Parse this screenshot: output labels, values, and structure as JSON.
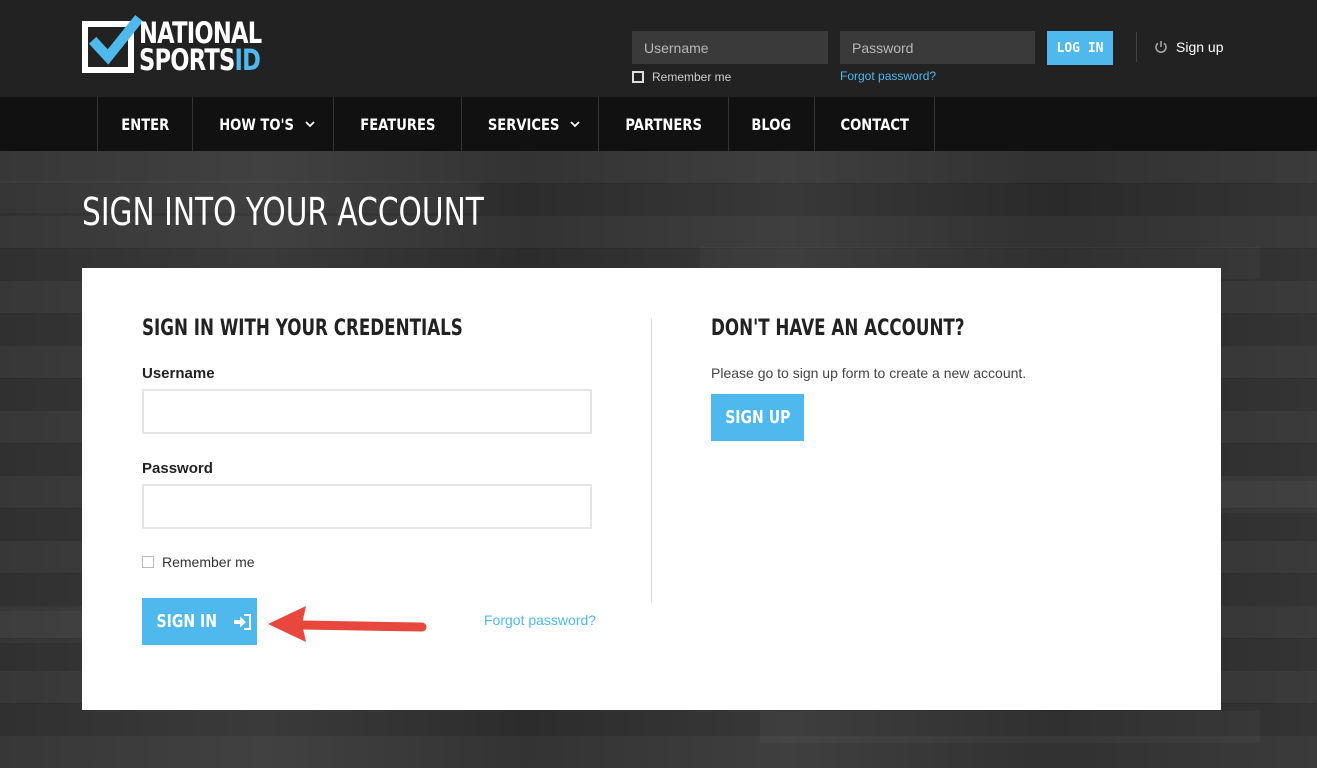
{
  "brand": {
    "line1": "NATIONAL",
    "line2_main": "SPORTS",
    "line2_accent": "ID",
    "accent_color": "#4fb8ec"
  },
  "header": {
    "username_placeholder": "Username",
    "password_placeholder": "Password",
    "remember_label": "Remember me",
    "forgot_label": "Forgot password?",
    "login_label": "LOG IN",
    "signup_label": "Sign up",
    "signup_icon": "power-icon"
  },
  "nav": {
    "items": [
      {
        "label": "ENTER"
      },
      {
        "label": "HOW TO'S",
        "dropdown": true
      },
      {
        "label": "FEATURES"
      },
      {
        "label": "SERVICES",
        "dropdown": true
      },
      {
        "label": "PARTNERS"
      },
      {
        "label": "BLOG"
      },
      {
        "label": "CONTACT"
      }
    ]
  },
  "page": {
    "title": "SIGN INTO YOUR ACCOUNT"
  },
  "signin": {
    "heading": "SIGN IN WITH YOUR CREDENTIALS",
    "username_label": "Username",
    "username_value": "",
    "password_label": "Password",
    "password_value": "",
    "remember_label": "Remember me",
    "button_label": "SIGN IN",
    "button_icon": "sign-in-icon",
    "forgot_label": "Forgot password?"
  },
  "signup": {
    "heading": "DON'T HAVE AN ACCOUNT?",
    "description": "Please go to sign up form to create a new account.",
    "button_label": "SIGN UP"
  },
  "annotation": {
    "arrow_color": "#e8473d"
  }
}
